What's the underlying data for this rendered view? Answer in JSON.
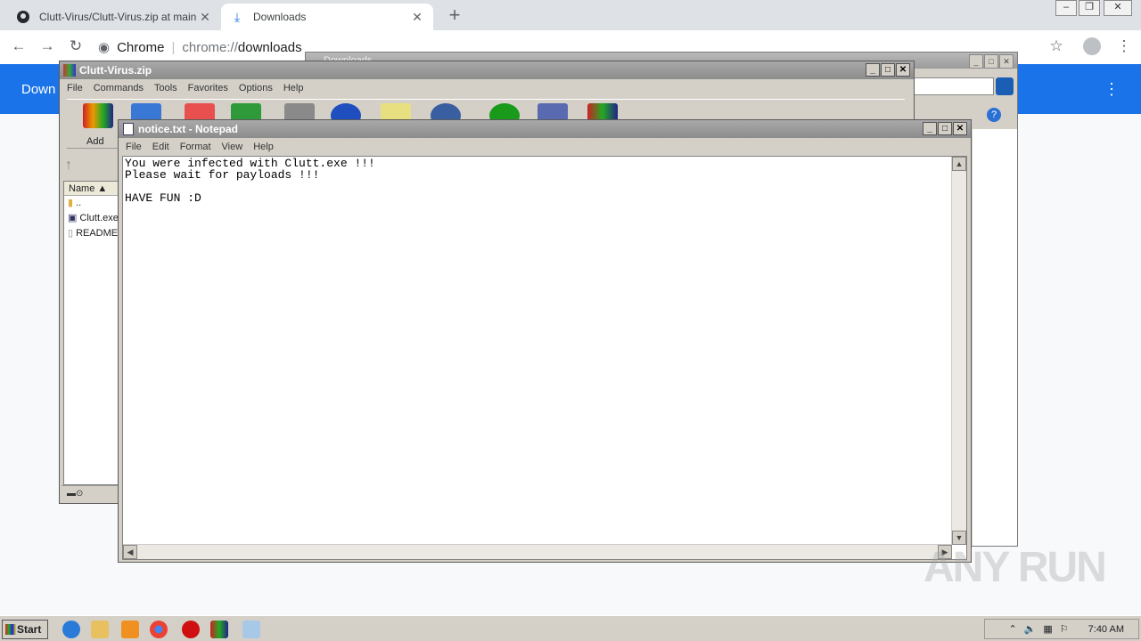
{
  "browser": {
    "tabs": [
      {
        "label": "Clutt-Virus/Clutt-Virus.zip at main · N",
        "icon": "github-icon"
      },
      {
        "label": "Downloads",
        "icon": "download-icon"
      }
    ],
    "omnibox_site": "Chrome",
    "omnibox_scheme": "chrome://",
    "omnibox_path": "downloads",
    "page_header": "Down"
  },
  "back_window": {
    "title": "Downloads"
  },
  "winrar": {
    "title": "Clutt-Virus.zip",
    "menu": [
      "File",
      "Commands",
      "Tools",
      "Favorites",
      "Options",
      "Help"
    ],
    "add_label": "Add",
    "column_name": "Name",
    "files": [
      {
        "name": ".."
      },
      {
        "name": "Clutt.exe"
      },
      {
        "name": "README"
      }
    ]
  },
  "notepad": {
    "title": "notice.txt - Notepad",
    "menu": [
      "File",
      "Edit",
      "Format",
      "View",
      "Help"
    ],
    "content": "You were infected with Clutt.exe !!!\nPlease wait for payloads !!!\n\nHAVE FUN :D"
  },
  "taskbar": {
    "start_label": "Start",
    "clock": "7:40 AM"
  },
  "watermark": "ANY RUN",
  "colors": {
    "chrome_blue": "#1a73e8",
    "win_gray": "#d4d0c8"
  }
}
